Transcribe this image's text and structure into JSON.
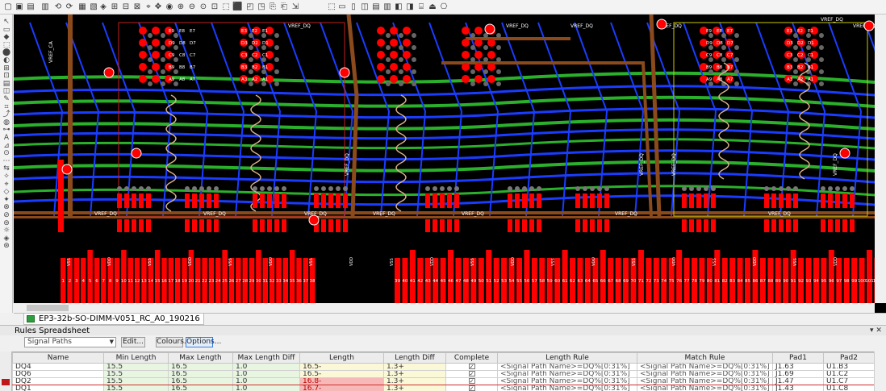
{
  "document": {
    "tab_label": "EP3-32b-SO-DIMM-V051_RC_A0_190216"
  },
  "pcb": {
    "net_labels_top": [
      "VREF_DQ",
      "VREF_DQ",
      "VREF_DQ",
      "VREF_DQ",
      "VREF_DQ",
      "VREF_DQ"
    ],
    "net_labels_mid": [
      "VREF_DQ",
      "VREF_DQ",
      "VREF_DQ",
      "VREF_DQ",
      "VREF_DQ",
      "VREF_DQ",
      "VREF_DQ"
    ],
    "vertical_labels": [
      "VREF_CA",
      "VREF_DQ",
      "VREF_DQ",
      "VREF_DQ",
      "VREF_DQ"
    ],
    "bga_labels": [
      [
        "E9",
        "E8",
        "E7",
        "D9",
        "D8",
        "D7",
        "C9",
        "C8",
        "C7",
        "B9",
        "B8",
        "B7",
        "A9",
        "A8",
        "A7"
      ],
      [
        "E3",
        "E2",
        "E1",
        "D3",
        "D2",
        "D1",
        "C3",
        "C2",
        "C1",
        "B3",
        "B2",
        "B1",
        "A3",
        "A2",
        "A1"
      ]
    ],
    "pad_numbers_left": [
      "1",
      "2",
      "3",
      "4",
      "5",
      "6",
      "7",
      "8",
      "9",
      "10",
      "11",
      "12",
      "13",
      "14",
      "15",
      "16",
      "17",
      "18",
      "19",
      "20",
      "21",
      "22",
      "23",
      "24",
      "25",
      "26",
      "27",
      "28",
      "29",
      "30",
      "31",
      "32",
      "33",
      "34",
      "35",
      "36",
      "37",
      "38"
    ],
    "pad_numbers_right": [
      "39",
      "40",
      "41",
      "42",
      "43",
      "44",
      "45",
      "46",
      "47",
      "48",
      "49",
      "50",
      "51",
      "52",
      "53",
      "54",
      "55",
      "56",
      "57",
      "58",
      "59",
      "60",
      "61",
      "62",
      "63",
      "64",
      "65",
      "66",
      "67",
      "68",
      "69",
      "70",
      "71",
      "72",
      "73",
      "74",
      "75",
      "76",
      "77",
      "78",
      "79",
      "80",
      "81",
      "82",
      "83",
      "84",
      "85",
      "86",
      "87",
      "88",
      "89",
      "90",
      "91",
      "92",
      "93",
      "94",
      "95",
      "96",
      "97",
      "98",
      "99",
      "100",
      "101",
      "102",
      "103"
    ],
    "finger_labels": [
      "VSS",
      "VDD"
    ],
    "colors": {
      "background": "#000000",
      "copper_top": "#ff0000",
      "copper_inner": "#1a3cff",
      "green_layer": "#2bb02b",
      "brown_layer": "#8b4a1c",
      "silk": "#ffffff",
      "diff_pair": "#d9b38c",
      "outline": "#c8c800"
    }
  },
  "rules_panel": {
    "title": "Rules Spreadsheet",
    "controls": "▾ ✕",
    "filter_select": "Signal Paths",
    "buttons": {
      "edit": "Edit...",
      "colours": "Colours...",
      "options": "Options..."
    },
    "columns": [
      "Name",
      "Min Length",
      "Max Length",
      "Max Length Diff",
      "Length",
      "Length Diff",
      "Complete",
      "Length Rule",
      "Match Rule",
      "Pad1",
      "Pad2"
    ],
    "rows": [
      {
        "name": "DQ4",
        "min": "15.5",
        "max": "16.5",
        "maxdiff": "1.0",
        "length": "16.5-",
        "diff": "1.3+",
        "complete": true,
        "length_rule": "<Signal Path Name>=DQ%[0:31%]",
        "match_rule": "<Signal Path Name>=DQ%[0:31%]",
        "pad1": "J1.63",
        "pad2": "U1.B3",
        "bad": false,
        "selected": false
      },
      {
        "name": "DQ6",
        "min": "15.5",
        "max": "16.5",
        "maxdiff": "1.0",
        "length": "16.5-",
        "diff": "1.3+",
        "complete": true,
        "length_rule": "<Signal Path Name>=DQ%[0:31%]",
        "match_rule": "<Signal Path Name>=DQ%[0:31%]",
        "pad1": "J1.69",
        "pad2": "U1.C2",
        "bad": false,
        "selected": false
      },
      {
        "name": "DQ2",
        "min": "15.5",
        "max": "16.5",
        "maxdiff": "1.0",
        "length": "16.8-",
        "diff": "1.3+",
        "complete": true,
        "length_rule": "<Signal Path Name>=DQ%[0:31%]",
        "match_rule": "<Signal Path Name>=DQ%[0:31%]",
        "pad1": "J1.47",
        "pad2": "U1.C7",
        "bad": true,
        "selected": true
      },
      {
        "name": "DQ1",
        "min": "15.5",
        "max": "16.5",
        "maxdiff": "1.0",
        "length": "16.7-",
        "diff": "1.3+",
        "complete": true,
        "length_rule": "<Signal Path Name>=DQ%[0:31%]",
        "match_rule": "<Signal Path Name>=DQ%[0:31%]",
        "pad1": "J1.43",
        "pad2": "U1.C8",
        "bad": true,
        "selected": false
      }
    ]
  }
}
